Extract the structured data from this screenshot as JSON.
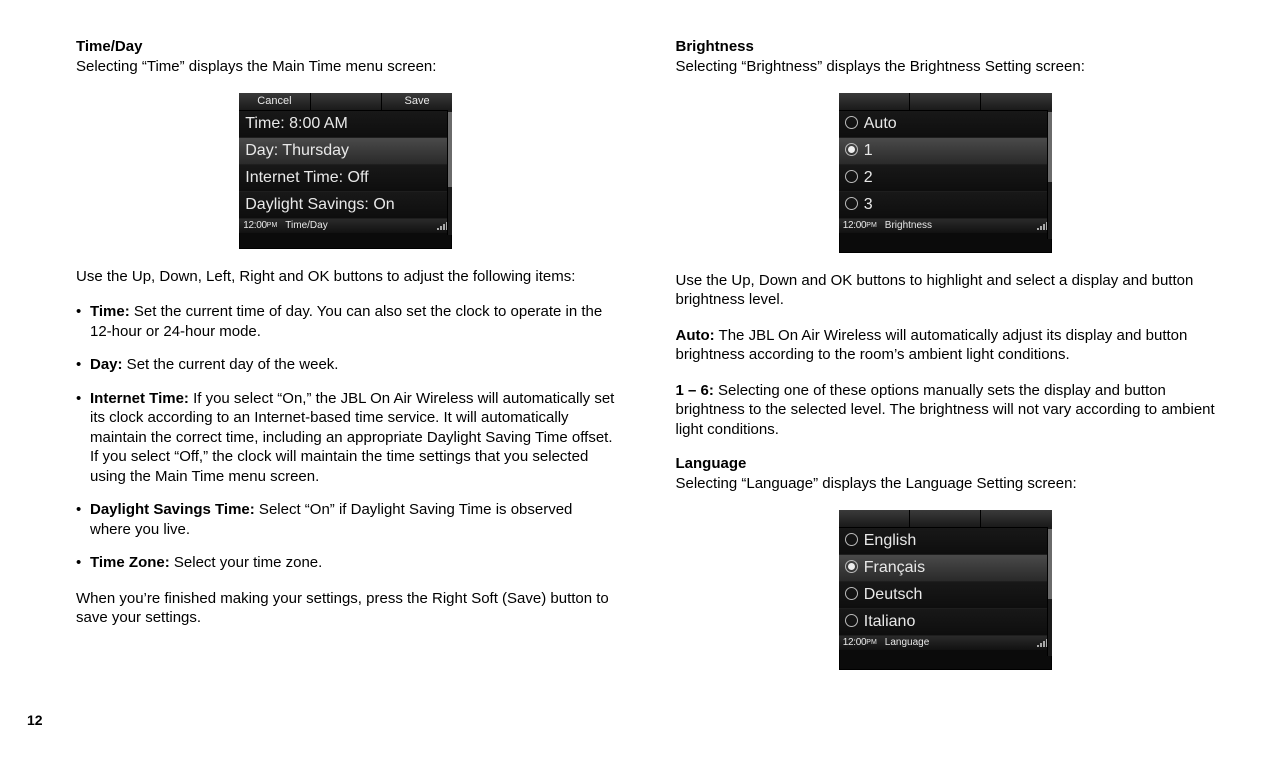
{
  "page_number": "12",
  "timeday": {
    "heading": "Time/Day",
    "intro": "Selecting “Time” displays the Main Time menu screen:",
    "screen": {
      "topbar": {
        "left": "Cancel",
        "mid": "",
        "right": "Save"
      },
      "rows": [
        {
          "label": "Time: 8:00 AM",
          "selected": false
        },
        {
          "label": "Day: Thursday",
          "selected": true
        },
        {
          "label": "Internet Time: Off",
          "selected": false
        },
        {
          "label": "Daylight Savings: On",
          "selected": false
        }
      ],
      "status": {
        "clock": "12:00",
        "ampm": "PM",
        "title": "Time/Day"
      }
    },
    "after_screen": "Use the Up, Down, Left, Right and OK buttons to adjust the following items:",
    "bullets": [
      {
        "lead": "Time:",
        "rest": " Set the current time of day. You can also set the clock to operate in the 12-hour or 24-hour mode."
      },
      {
        "lead": "Day:",
        "rest": " Set the current day of the week."
      },
      {
        "lead": "Internet Time:",
        "rest": " If you select “On,” the JBL On Air Wireless will automatically set its clock according to an Internet-based time service. It will automatically maintain the correct time, including an appropriate Daylight Saving Time offset. If you select “Off,” the clock will maintain the time settings that you selected using the Main Time menu screen."
      },
      {
        "lead": "Daylight Savings Time:",
        "rest": " Select “On” if Daylight Saving Time is observed where you live."
      },
      {
        "lead": "Time Zone:",
        "rest": " Select your time zone."
      }
    ],
    "closing": "When you’re finished making your settings, press the Right Soft (Save) button to save your settings."
  },
  "brightness": {
    "heading": "Brightness",
    "intro": "Selecting “Brightness” displays the Brightness Setting screen:",
    "screen": {
      "rows": [
        {
          "label": "Auto",
          "selected": false
        },
        {
          "label": "1",
          "selected": true
        },
        {
          "label": "2",
          "selected": false
        },
        {
          "label": "3",
          "selected": false
        }
      ],
      "status": {
        "clock": "12:00",
        "ampm": "PM",
        "title": "Brightness"
      }
    },
    "after_screen": "Use the Up, Down and OK buttons to highlight and select a display and button brightness level.",
    "auto_lead": "Auto:",
    "auto_rest": " The JBL On Air Wireless will automatically adjust its display and button brightness according to the room’s ambient light conditions.",
    "range_lead": "1 – 6:",
    "range_rest": " Selecting one of these options manually sets the display and button brightness to the selected level. The brightness will not vary according to ambient light conditions."
  },
  "language": {
    "heading": "Language",
    "intro": "Selecting “Language” displays the Language Setting screen:",
    "screen": {
      "rows": [
        {
          "label": "English",
          "selected": false
        },
        {
          "label": "Français",
          "selected": true
        },
        {
          "label": "Deutsch",
          "selected": false
        },
        {
          "label": "Italiano",
          "selected": false
        }
      ],
      "status": {
        "clock": "12:00",
        "ampm": "PM",
        "title": "Language"
      }
    }
  }
}
